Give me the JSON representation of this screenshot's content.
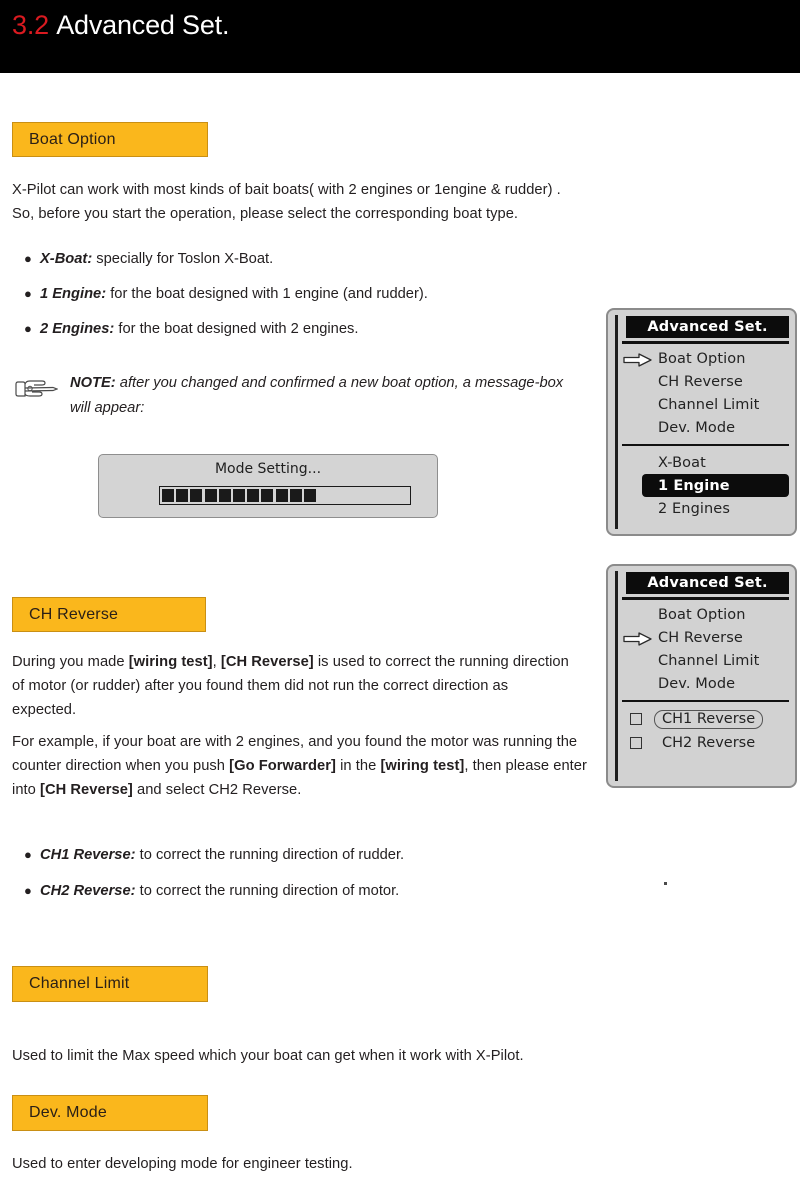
{
  "header": {
    "number": "3.2",
    "title": "Advanced Set."
  },
  "sections": {
    "boat_option": {
      "heading": "Boat Option",
      "intro": "X-Pilot can work with most kinds of bait boats( with 2 engines or 1engine & rudder) . So, before you start the operation, please select the corresponding boat type.",
      "bullets": [
        {
          "term": "X-Boat:",
          "rest": " specially for Toslon X-Boat."
        },
        {
          "term": "1 Engine:",
          "rest": " for the boat designed with 1 engine (and rudder)."
        },
        {
          "term": "2 Engines:",
          "rest": " for the boat designed with 2 engines."
        }
      ],
      "note_label": "NOTE:",
      "note_text": " after you changed and confirmed a new boat option, a message-box will appear:"
    },
    "ch_reverse": {
      "heading": "CH Reverse",
      "para1_parts": [
        {
          "text": "During you made ",
          "bold": false
        },
        {
          "text": "[wiring test]",
          "bold": true
        },
        {
          "text": ", ",
          "bold": false
        },
        {
          "text": "[CH Reverse]",
          "bold": true
        },
        {
          "text": " is used to correct the running direction of motor (or rudder) after you found them did not run the correct direction as expected.",
          "bold": false
        }
      ],
      "para2_parts": [
        {
          "text": "For example, if your boat are with 2 engines, and you found the motor was running the counter direction when you push ",
          "bold": false
        },
        {
          "text": "[Go Forwarder]",
          "bold": true
        },
        {
          "text": " in the ",
          "bold": false
        },
        {
          "text": "[wiring test]",
          "bold": true
        },
        {
          "text": ", then please enter into ",
          "bold": false
        },
        {
          "text": "[CH Reverse]",
          "bold": true
        },
        {
          "text": " and select CH2 Reverse.",
          "bold": false
        }
      ],
      "bullets": [
        {
          "term": "CH1 Reverse:",
          "rest": " to correct the running direction of rudder."
        },
        {
          "term": "CH2 Reverse:",
          "rest": " to correct the running direction of motor."
        }
      ]
    },
    "channel_limit": {
      "heading": "Channel Limit",
      "body": "Used to limit the Max speed which your boat can get when it work with X-Pilot."
    },
    "dev_mode": {
      "heading": "Dev. Mode",
      "body": "Used to enter developing mode for engineer testing."
    }
  },
  "dialog": {
    "title": "Mode Setting...",
    "progress_blocks": 11,
    "progress_total": 19
  },
  "device_panel_1": {
    "title": "Advanced Set.",
    "menu": [
      {
        "label": "Boat Option",
        "selected": true
      },
      {
        "label": "CH Reverse",
        "selected": false
      },
      {
        "label": "Channel Limit",
        "selected": false
      },
      {
        "label": "Dev. Mode",
        "selected": false
      }
    ],
    "options": [
      {
        "label": "X-Boat",
        "highlighted": false
      },
      {
        "label": "1 Engine",
        "highlighted": true
      },
      {
        "label": "2 Engines",
        "highlighted": false
      }
    ]
  },
  "device_panel_2": {
    "title": "Advanced Set.",
    "menu": [
      {
        "label": "Boat Option",
        "selected": false
      },
      {
        "label": "CH Reverse",
        "selected": true
      },
      {
        "label": "Channel Limit",
        "selected": false
      },
      {
        "label": "Dev. Mode",
        "selected": false
      }
    ],
    "checks": [
      {
        "label": "CH1 Reverse",
        "checked": false,
        "focused": true
      },
      {
        "label": "CH2 Reverse",
        "checked": false,
        "focused": false
      }
    ]
  },
  "colors": {
    "accent_orange": "#fab71c",
    "orange_border": "#c98f14",
    "header_black": "#000000",
    "header_red": "#d91a20",
    "device_gray": "#d2d2d2",
    "text": "#231f20"
  }
}
